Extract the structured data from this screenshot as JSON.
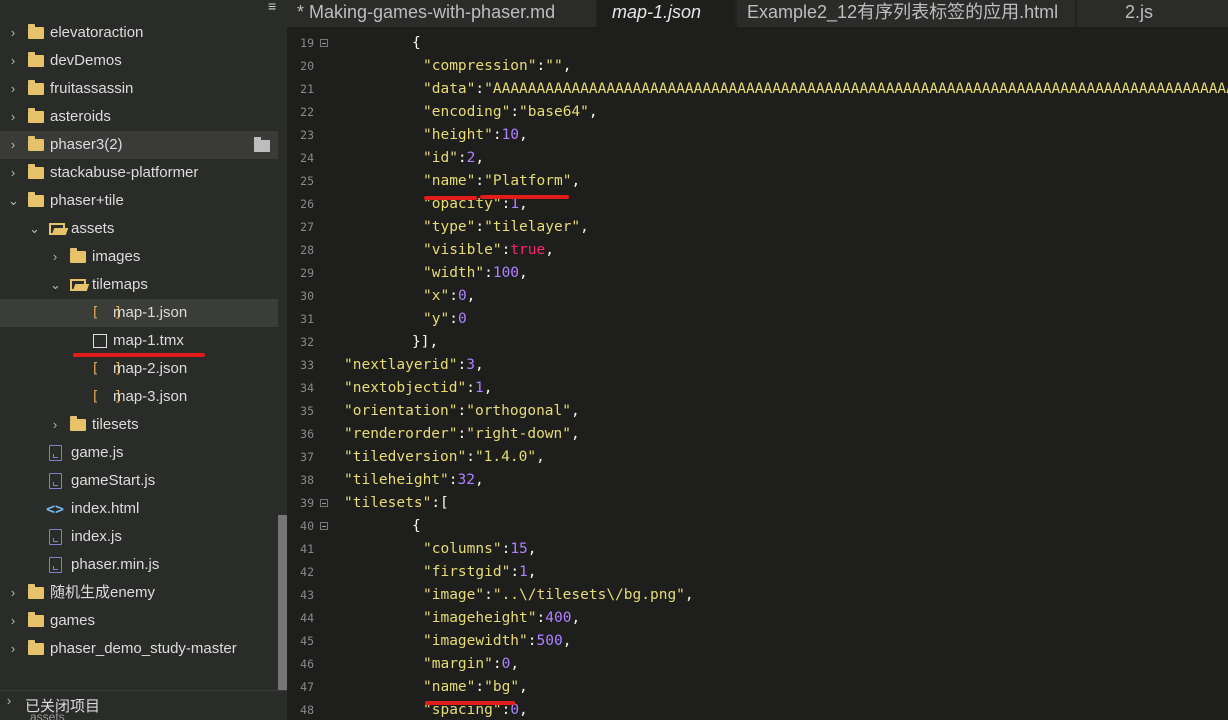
{
  "sidebar": {
    "menu_icon": "hamburger-menu-icon",
    "items": [
      {
        "label": "elevatoraction",
        "type": "folder",
        "indent": 0,
        "expanded": false
      },
      {
        "label": "devDemos",
        "type": "folder",
        "indent": 0,
        "expanded": false
      },
      {
        "label": "fruitassassin",
        "type": "folder",
        "indent": 0,
        "expanded": false
      },
      {
        "label": "asteroids",
        "type": "folder",
        "indent": 0,
        "expanded": false
      },
      {
        "label": "phaser3(2)",
        "type": "folder",
        "indent": 0,
        "expanded": false
      },
      {
        "label": "stackabuse-platformer",
        "type": "folder",
        "indent": 0,
        "expanded": false
      },
      {
        "label": "phaser+tile",
        "type": "folder",
        "indent": 0,
        "expanded": true
      },
      {
        "label": "assets",
        "type": "folder",
        "indent": 1,
        "expanded": true
      },
      {
        "label": "images",
        "type": "folder",
        "indent": 2,
        "expanded": false
      },
      {
        "label": "tilemaps",
        "type": "folder",
        "indent": 2,
        "expanded": true
      },
      {
        "label": "map-1.json",
        "type": "json",
        "indent": 3
      },
      {
        "label": "map-1.tmx",
        "type": "file",
        "indent": 3
      },
      {
        "label": "map-2.json",
        "type": "json",
        "indent": 3
      },
      {
        "label": "map-3.json",
        "type": "json",
        "indent": 3
      },
      {
        "label": "tilesets",
        "type": "folder",
        "indent": 2,
        "expanded": false
      },
      {
        "label": "game.js",
        "type": "js",
        "indent": 1
      },
      {
        "label": "gameStart.js",
        "type": "js",
        "indent": 1
      },
      {
        "label": "index.html",
        "type": "html",
        "indent": 1
      },
      {
        "label": "index.js",
        "type": "js",
        "indent": 1
      },
      {
        "label": "phaser.min.js",
        "type": "js",
        "indent": 1
      },
      {
        "label": "随机生成enemy",
        "type": "folder",
        "indent": 0,
        "expanded": false
      },
      {
        "label": "games",
        "type": "folder",
        "indent": 0,
        "expanded": false
      },
      {
        "label": "phaser_demo_study-master",
        "type": "folder",
        "indent": 0,
        "expanded": false
      }
    ],
    "footer_label": "已关闭项目",
    "footer_sub": "assets"
  },
  "tabs": [
    {
      "label": "* Making-games-with-phaser.md",
      "active": false
    },
    {
      "label": "map-1.json",
      "active": true
    },
    {
      "label": "Example2_12有序列表标签的应用.html",
      "active": false
    },
    {
      "label": "2.js",
      "active": false
    }
  ],
  "editor": {
    "lines": [
      {
        "num": "19",
        "fold": true,
        "indent": 2,
        "tokens": [
          [
            "p",
            "{"
          ]
        ]
      },
      {
        "num": "20",
        "indent": 3,
        "tokens": [
          [
            "s",
            "\"compression\""
          ],
          [
            "p",
            ":"
          ],
          [
            "s",
            "\"\""
          ],
          [
            "p",
            ","
          ]
        ]
      },
      {
        "num": "21",
        "indent": 3,
        "tokens": [
          [
            "s",
            "\"data\""
          ],
          [
            "p",
            ":"
          ],
          [
            "s",
            "\"AAAAAAAAAAAAAAAAAAAAAAAAAAAAAAAAAAAAAAAAAAAAAAAAAAAAAAAAAAAAAAAAAAAAAAAAAAAAAAAAAAAAAAAAAA"
          ]
        ]
      },
      {
        "num": "22",
        "indent": 3,
        "tokens": [
          [
            "s",
            "\"encoding\""
          ],
          [
            "p",
            ":"
          ],
          [
            "s",
            "\"base64\""
          ],
          [
            "p",
            ","
          ]
        ]
      },
      {
        "num": "23",
        "indent": 3,
        "tokens": [
          [
            "s",
            "\"height\""
          ],
          [
            "p",
            ":"
          ],
          [
            "n",
            "10"
          ],
          [
            "p",
            ","
          ]
        ]
      },
      {
        "num": "24",
        "indent": 3,
        "tokens": [
          [
            "s",
            "\"id\""
          ],
          [
            "p",
            ":"
          ],
          [
            "n",
            "2"
          ],
          [
            "p",
            ","
          ]
        ]
      },
      {
        "num": "25",
        "indent": 3,
        "tokens": [
          [
            "s",
            "\"name\""
          ],
          [
            "p",
            ":"
          ],
          [
            "s",
            "\"Platform\""
          ],
          [
            "p",
            ","
          ]
        ]
      },
      {
        "num": "26",
        "indent": 3,
        "tokens": [
          [
            "s",
            "\"opacity\""
          ],
          [
            "p",
            ":"
          ],
          [
            "n",
            "1"
          ],
          [
            "p",
            ","
          ]
        ]
      },
      {
        "num": "27",
        "indent": 3,
        "tokens": [
          [
            "s",
            "\"type\""
          ],
          [
            "p",
            ":"
          ],
          [
            "s",
            "\"tilelayer\""
          ],
          [
            "p",
            ","
          ]
        ]
      },
      {
        "num": "28",
        "indent": 3,
        "tokens": [
          [
            "s",
            "\"visible\""
          ],
          [
            "p",
            ":"
          ],
          [
            "kw",
            "true"
          ],
          [
            "p",
            ","
          ]
        ]
      },
      {
        "num": "29",
        "indent": 3,
        "tokens": [
          [
            "s",
            "\"width\""
          ],
          [
            "p",
            ":"
          ],
          [
            "n",
            "100"
          ],
          [
            "p",
            ","
          ]
        ]
      },
      {
        "num": "30",
        "indent": 3,
        "tokens": [
          [
            "s",
            "\"x\""
          ],
          [
            "p",
            ":"
          ],
          [
            "n",
            "0"
          ],
          [
            "p",
            ","
          ]
        ]
      },
      {
        "num": "31",
        "indent": 3,
        "tokens": [
          [
            "s",
            "\"y\""
          ],
          [
            "p",
            ":"
          ],
          [
            "n",
            "0"
          ]
        ]
      },
      {
        "num": "32",
        "indent": 2,
        "tokens": [
          [
            "p",
            "}],"
          ]
        ]
      },
      {
        "num": "33",
        "indent": 0,
        "tokens": [
          [
            "s",
            "\"nextlayerid\""
          ],
          [
            "p",
            ":"
          ],
          [
            "n",
            "3"
          ],
          [
            "p",
            ","
          ]
        ]
      },
      {
        "num": "34",
        "indent": 0,
        "tokens": [
          [
            "s",
            "\"nextobjectid\""
          ],
          [
            "p",
            ":"
          ],
          [
            "n",
            "1"
          ],
          [
            "p",
            ","
          ]
        ]
      },
      {
        "num": "35",
        "indent": 0,
        "tokens": [
          [
            "s",
            "\"orientation\""
          ],
          [
            "p",
            ":"
          ],
          [
            "s",
            "\"orthogonal\""
          ],
          [
            "p",
            ","
          ]
        ]
      },
      {
        "num": "36",
        "indent": 0,
        "tokens": [
          [
            "s",
            "\"renderorder\""
          ],
          [
            "p",
            ":"
          ],
          [
            "s",
            "\"right-down\""
          ],
          [
            "p",
            ","
          ]
        ]
      },
      {
        "num": "37",
        "indent": 0,
        "tokens": [
          [
            "s",
            "\"tiledversion\""
          ],
          [
            "p",
            ":"
          ],
          [
            "s",
            "\"1.4.0\""
          ],
          [
            "p",
            ","
          ]
        ]
      },
      {
        "num": "38",
        "indent": 0,
        "tokens": [
          [
            "s",
            "\"tileheight\""
          ],
          [
            "p",
            ":"
          ],
          [
            "n",
            "32"
          ],
          [
            "p",
            ","
          ]
        ]
      },
      {
        "num": "39",
        "fold": true,
        "indent": 0,
        "tokens": [
          [
            "s",
            "\"tilesets\""
          ],
          [
            "p",
            ":["
          ]
        ]
      },
      {
        "num": "40",
        "fold": true,
        "indent": 2,
        "tokens": [
          [
            "p",
            "{"
          ]
        ]
      },
      {
        "num": "41",
        "indent": 3,
        "tokens": [
          [
            "s",
            "\"columns\""
          ],
          [
            "p",
            ":"
          ],
          [
            "n",
            "15"
          ],
          [
            "p",
            ","
          ]
        ]
      },
      {
        "num": "42",
        "indent": 3,
        "tokens": [
          [
            "s",
            "\"firstgid\""
          ],
          [
            "p",
            ":"
          ],
          [
            "n",
            "1"
          ],
          [
            "p",
            ","
          ]
        ]
      },
      {
        "num": "43",
        "indent": 3,
        "tokens": [
          [
            "s",
            "\"image\""
          ],
          [
            "p",
            ":"
          ],
          [
            "s",
            "\"..\\/tilesets\\/bg.png\""
          ],
          [
            "p",
            ","
          ]
        ]
      },
      {
        "num": "44",
        "indent": 3,
        "tokens": [
          [
            "s",
            "\"imageheight\""
          ],
          [
            "p",
            ":"
          ],
          [
            "n",
            "400"
          ],
          [
            "p",
            ","
          ]
        ]
      },
      {
        "num": "45",
        "indent": 3,
        "tokens": [
          [
            "s",
            "\"imagewidth\""
          ],
          [
            "p",
            ":"
          ],
          [
            "n",
            "500"
          ],
          [
            "p",
            ","
          ]
        ]
      },
      {
        "num": "46",
        "indent": 3,
        "tokens": [
          [
            "s",
            "\"margin\""
          ],
          [
            "p",
            ":"
          ],
          [
            "n",
            "0"
          ],
          [
            "p",
            ","
          ]
        ]
      },
      {
        "num": "47",
        "indent": 3,
        "tokens": [
          [
            "s",
            "\"name\""
          ],
          [
            "p",
            ":"
          ],
          [
            "s",
            "\"bg\""
          ],
          [
            "p",
            ","
          ]
        ]
      },
      {
        "num": "48",
        "indent": 3,
        "tokens": [
          [
            "s",
            "\"spacing\""
          ],
          [
            "p",
            ":"
          ],
          [
            "n",
            "0"
          ],
          [
            "p",
            ","
          ]
        ]
      }
    ]
  },
  "colors": {
    "string": "#e6db74",
    "number": "#ae81ff",
    "keyword": "#f92672",
    "folder": "#e6c26a",
    "annotation": "#e21b1b"
  }
}
